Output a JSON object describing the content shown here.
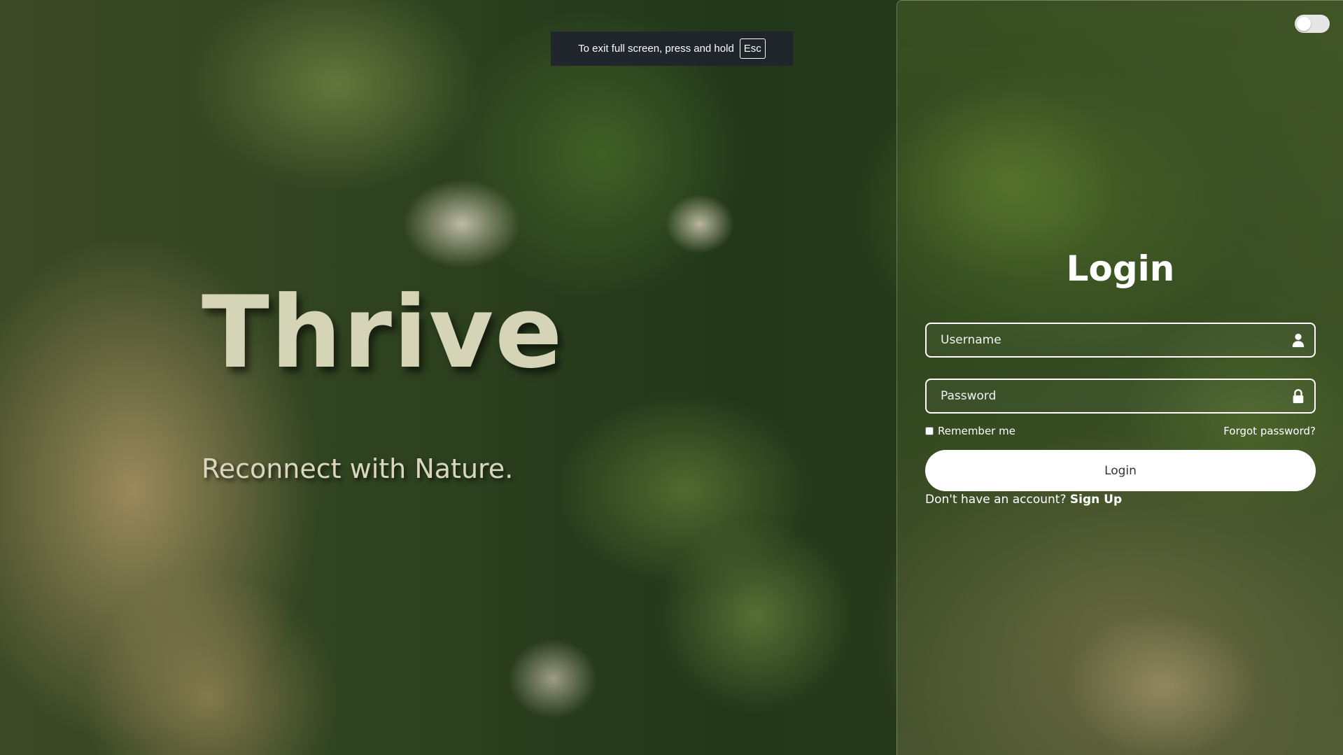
{
  "fullscreen_notice": {
    "message": "To exit full screen, press and hold",
    "key": "Esc"
  },
  "hero": {
    "title": "Thrive",
    "tagline": "Reconnect with Nature."
  },
  "login": {
    "title": "Login",
    "username_placeholder": "Username",
    "password_placeholder": "Password",
    "remember_label": "Remember me",
    "forgot_label": "Forgot password?",
    "submit_label": "Login",
    "signup_prompt": "Don't have an account?",
    "signup_label": "Sign Up"
  },
  "icons": {
    "username": "user-icon",
    "password": "lock-icon"
  },
  "colors": {
    "accent": "#ffffff",
    "hero_text": "#d6d4b7",
    "button_text": "#333333"
  }
}
